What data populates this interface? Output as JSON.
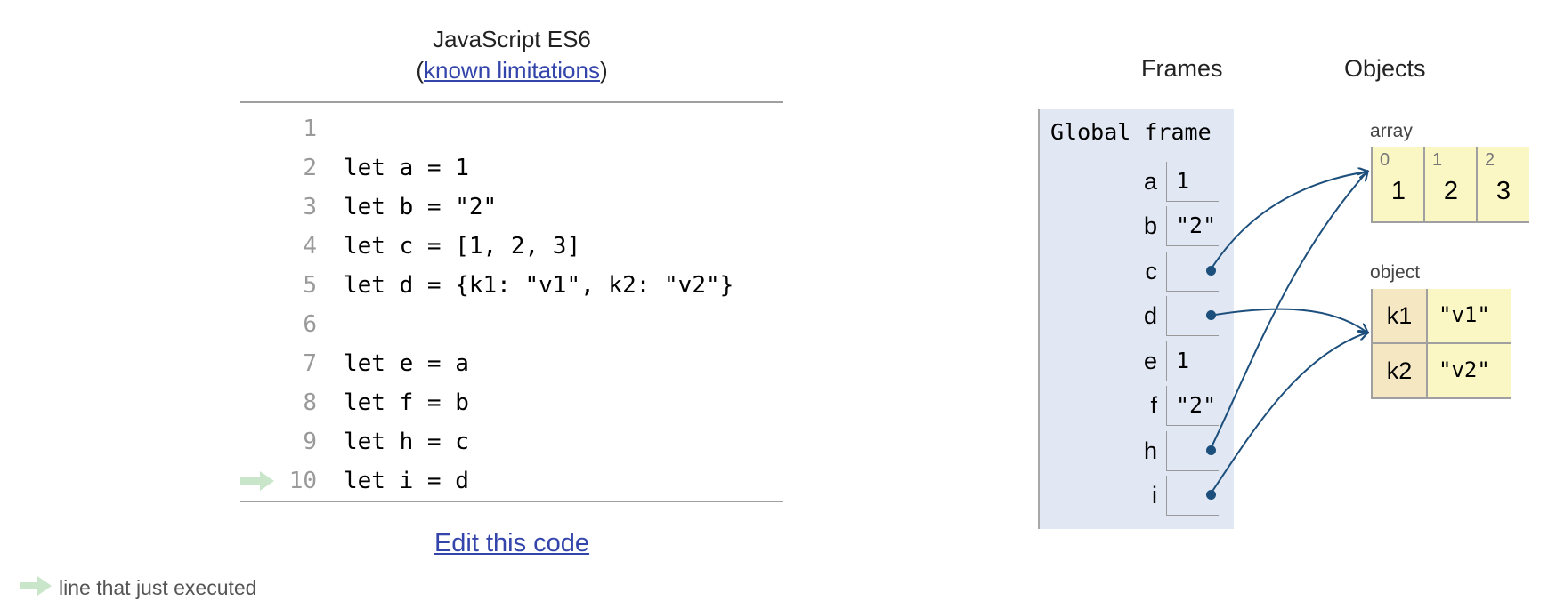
{
  "header": {
    "language": "JavaScript ES6",
    "paren_open": "(",
    "limitations_link": "known limitations",
    "paren_close": ")"
  },
  "code_lines": [
    {
      "num": "1",
      "text": ""
    },
    {
      "num": "2",
      "text": "let a = 1"
    },
    {
      "num": "3",
      "text": "let b = \"2\""
    },
    {
      "num": "4",
      "text": "let c = [1, 2, 3]"
    },
    {
      "num": "5",
      "text": "let d = {k1: \"v1\", k2: \"v2\"}"
    },
    {
      "num": "6",
      "text": ""
    },
    {
      "num": "7",
      "text": "let e = a"
    },
    {
      "num": "8",
      "text": "let f = b"
    },
    {
      "num": "9",
      "text": "let h = c"
    },
    {
      "num": "10",
      "text": "let i = d"
    }
  ],
  "current_line": "10",
  "edit_link": "Edit this code",
  "legend": {
    "text": "line that just executed",
    "arrow_color": "#c9e6ca"
  },
  "viz": {
    "frames_header": "Frames",
    "objects_header": "Objects",
    "frame_title": "Global frame",
    "variables": [
      {
        "name": "a",
        "value": "1"
      },
      {
        "name": "b",
        "value": "\"2\""
      },
      {
        "name": "c",
        "value": ""
      },
      {
        "name": "d",
        "value": ""
      },
      {
        "name": "e",
        "value": "1"
      },
      {
        "name": "f",
        "value": "\"2\""
      },
      {
        "name": "h",
        "value": ""
      },
      {
        "name": "i",
        "value": ""
      }
    ],
    "array_label": "array",
    "array_items": [
      {
        "index": "0",
        "value": "1"
      },
      {
        "index": "1",
        "value": "2"
      },
      {
        "index": "2",
        "value": "3"
      }
    ],
    "object_label": "object",
    "object_entries": [
      {
        "key": "k1",
        "value": "\"v1\""
      },
      {
        "key": "k2",
        "value": "\"v2\""
      }
    ],
    "pointer_color": "#1d4f7c"
  }
}
